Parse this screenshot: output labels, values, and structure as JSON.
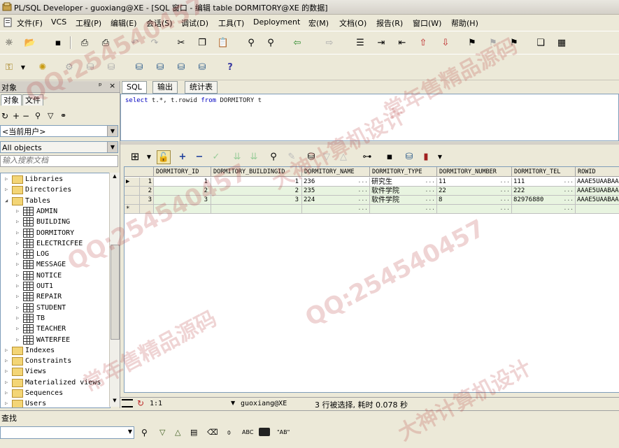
{
  "window": {
    "title": "PL/SQL Developer - guoxiang@XE - [SQL 窗口 - 编辑 table DORMITORY@XE 的数据]"
  },
  "menu": [
    "文件(F)",
    "VCS",
    "工程(P)",
    "编辑(E)",
    "会话(S)",
    "调试(D)",
    "工具(T)",
    "Deployment",
    "宏(M)",
    "文档(O)",
    "报告(R)",
    "窗口(W)",
    "帮助(H)"
  ],
  "left_panel": {
    "header": "对象",
    "pin": "ᵖ",
    "close": "×",
    "tabs": [
      "对象",
      "文件"
    ],
    "user_combo": "<当前用户>",
    "filter_combo": "All objects",
    "search_placeholder": "输入搜索文档",
    "tree": {
      "folders_before": [
        "Libraries",
        "Directories"
      ],
      "tables_label": "Tables",
      "tables": [
        "ADMIN",
        "BUILDING",
        "DORMITORY",
        "ELECTRICFEE",
        "LOG",
        "MESSAGE",
        "NOTICE",
        "OUT1",
        "REPAIR",
        "STUDENT",
        "TB",
        "TEACHER",
        "WATERFEE"
      ],
      "folders_after": [
        "Indexes",
        "Constraints",
        "Views",
        "Materialized views",
        "Sequences",
        "Users"
      ]
    }
  },
  "sql_tabs": [
    "SQL",
    "输出",
    "统计表"
  ],
  "sql": {
    "kw1": "select",
    "part1": " t.*, t.rowid ",
    "kw2": "from",
    "part2": " DORMITORY t"
  },
  "grid": {
    "columns": [
      "DORMITORY_ID",
      "DORMITORY_BUILDINGID",
      "DORMITORY_NAME",
      "DORMITORY_TYPE",
      "DORMITORY_NUMBER",
      "DORMITORY_TEL",
      "ROWID"
    ],
    "rows": [
      [
        "1",
        "1",
        "236",
        "研究生",
        "11",
        "111",
        "AAAE5UAABAA"
      ],
      [
        "2",
        "2",
        "235",
        "软件学院",
        "22",
        "222",
        "AAAE5UAABAA"
      ],
      [
        "3",
        "3",
        "224",
        "软件学院",
        "8",
        "82976880",
        "AAAE5UAABAA"
      ]
    ],
    "new_row_marker": "*",
    "ellipsis": "···"
  },
  "status": {
    "position": "1:1",
    "connection": "guoxiang@XE",
    "message": "3 行被选择, 耗时 0.078 秒"
  },
  "find": {
    "label": "查找",
    "abc": "ABC",
    "ab": "\"AB\""
  },
  "watermarks": [
    "QQ:254540457",
    "常年售精品源码",
    "大神计算机设计"
  ]
}
